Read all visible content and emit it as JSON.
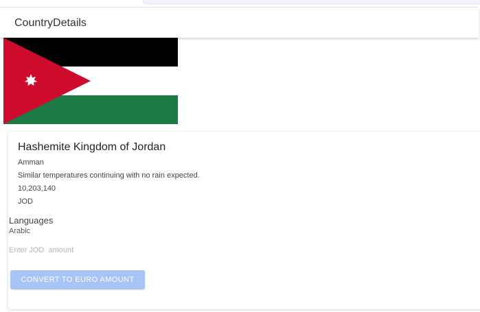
{
  "toolbar": {
    "title": "CountryDetails"
  },
  "flag": {
    "country": "Jordan",
    "icon": "jordan-flag",
    "colors": {
      "black": "#000000",
      "white": "#ffffff",
      "green": "#1d7a45",
      "red": "#ce0a2d",
      "star": "#ffffff"
    }
  },
  "country": {
    "name": "Hashemite Kingdom of Jordan",
    "capital": "Amman",
    "weather": "Similar temperatures continuing with no rain expected.",
    "population": "10,203,140",
    "currency": "JOD"
  },
  "languages": {
    "heading": "Languages",
    "items": [
      "Arabic"
    ]
  },
  "converter": {
    "placeholder": "Enter JOD  amount",
    "value": "",
    "button_label": "CONVERT TO EURO AMOUNT",
    "button_color": "#a7c4f7"
  }
}
